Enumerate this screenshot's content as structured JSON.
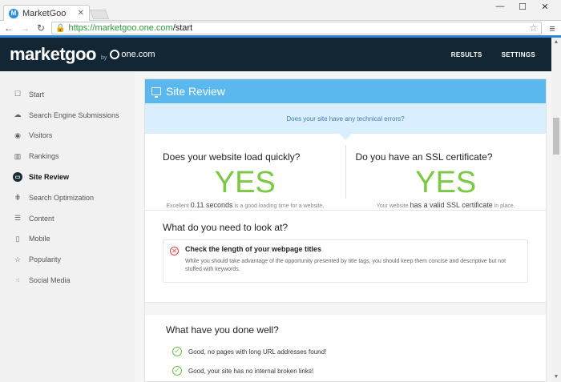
{
  "browser": {
    "tab_title": "MarketGoo",
    "url_host": "https://marketgoo.one.com",
    "url_path": "/start"
  },
  "header": {
    "brand": "marketgoo",
    "by": "by",
    "partner": "one.com",
    "nav": {
      "results": "RESULTS",
      "settings": "SETTINGS"
    }
  },
  "sidebar": {
    "items": [
      {
        "label": "Start",
        "icon": "square-icon"
      },
      {
        "label": "Search Engine Submissions",
        "icon": "cloud-upload-icon"
      },
      {
        "label": "Visitors",
        "icon": "user-icon"
      },
      {
        "label": "Rankings",
        "icon": "bar-chart-icon"
      },
      {
        "label": "Site Review",
        "icon": "monitor-icon",
        "active": true
      },
      {
        "label": "Search Optimization",
        "icon": "sliders-icon"
      },
      {
        "label": "Content",
        "icon": "lines-icon"
      },
      {
        "label": "Mobile",
        "icon": "mobile-icon"
      },
      {
        "label": "Popularity",
        "icon": "star-icon"
      },
      {
        "label": "Social Media",
        "icon": "share-icon"
      }
    ]
  },
  "review": {
    "title": "Site Review",
    "banner": "Does your site have any technical errors?",
    "speed": {
      "question": "Does your website load quickly?",
      "answer": "YES",
      "note_prefix": "Excellent",
      "note_value": "0.11 seconds",
      "note_suffix": "is a good loading time for a website."
    },
    "ssl": {
      "question": "Do you have an SSL certificate?",
      "answer": "YES",
      "note_prefix": "Your website",
      "note_value": "has a valid SSL certificate",
      "note_suffix": "in place."
    },
    "todo": {
      "title": "What do you need to look at?",
      "issue_title": "Check the length of your webpage titles",
      "issue_desc": "While you should take advantage of the opportunity presented by title tags, you should keep them concise and descriptive but not stuffed with keywords."
    },
    "done": {
      "title": "What have you done well?",
      "items": [
        "Good, no pages with long URL addresses found!",
        "Good, your site has no internal broken links!"
      ]
    }
  },
  "colors": {
    "header_bg": "#132634",
    "card_head": "#5bb8ef",
    "yes_green": "#7ac943",
    "error_red": "#e0433c"
  }
}
